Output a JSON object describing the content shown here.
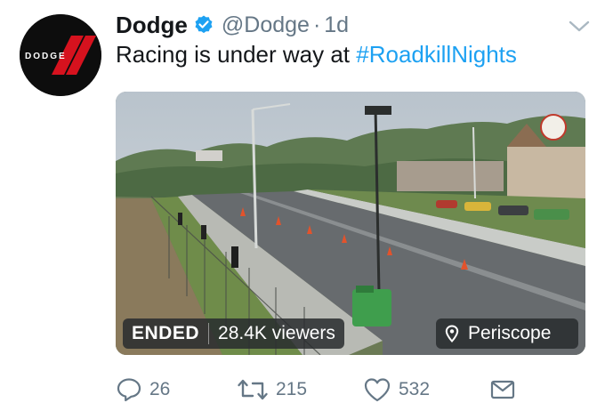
{
  "tweet": {
    "author_name": "Dodge",
    "handle": "@Dodge",
    "separator": "·",
    "time": "1d",
    "text_prefix": "Racing is under way at ",
    "hashtag": "#RoadkillNights",
    "avatar_brand_text": "DODGE",
    "icons": {
      "verified": "verified-badge-icon",
      "caret": "chevron-down-icon",
      "reply": "reply-icon",
      "retweet": "retweet-icon",
      "like": "heart-icon",
      "message": "envelope-icon",
      "location": "location-pin-icon"
    },
    "colors": {
      "accent": "#1da1f2",
      "brand_red": "#d6121e",
      "muted": "#657786"
    }
  },
  "media": {
    "status_label": "ENDED",
    "viewers_label": "28.4K viewers",
    "source_label": "Periscope"
  },
  "actions": {
    "replies": "26",
    "retweets": "215",
    "likes": "532"
  }
}
